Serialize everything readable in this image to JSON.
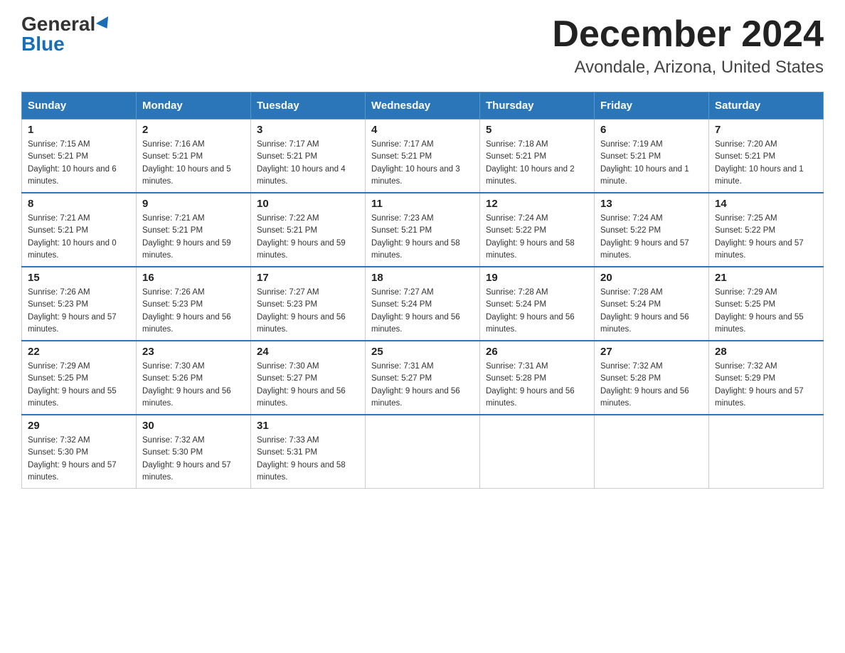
{
  "header": {
    "logo_general": "General",
    "logo_blue": "Blue",
    "title": "December 2024",
    "subtitle": "Avondale, Arizona, United States"
  },
  "days_of_week": [
    "Sunday",
    "Monday",
    "Tuesday",
    "Wednesday",
    "Thursday",
    "Friday",
    "Saturday"
  ],
  "weeks": [
    [
      {
        "day": "1",
        "sunrise": "7:15 AM",
        "sunset": "5:21 PM",
        "daylight": "10 hours and 6 minutes."
      },
      {
        "day": "2",
        "sunrise": "7:16 AM",
        "sunset": "5:21 PM",
        "daylight": "10 hours and 5 minutes."
      },
      {
        "day": "3",
        "sunrise": "7:17 AM",
        "sunset": "5:21 PM",
        "daylight": "10 hours and 4 minutes."
      },
      {
        "day": "4",
        "sunrise": "7:17 AM",
        "sunset": "5:21 PM",
        "daylight": "10 hours and 3 minutes."
      },
      {
        "day": "5",
        "sunrise": "7:18 AM",
        "sunset": "5:21 PM",
        "daylight": "10 hours and 2 minutes."
      },
      {
        "day": "6",
        "sunrise": "7:19 AM",
        "sunset": "5:21 PM",
        "daylight": "10 hours and 1 minute."
      },
      {
        "day": "7",
        "sunrise": "7:20 AM",
        "sunset": "5:21 PM",
        "daylight": "10 hours and 1 minute."
      }
    ],
    [
      {
        "day": "8",
        "sunrise": "7:21 AM",
        "sunset": "5:21 PM",
        "daylight": "10 hours and 0 minutes."
      },
      {
        "day": "9",
        "sunrise": "7:21 AM",
        "sunset": "5:21 PM",
        "daylight": "9 hours and 59 minutes."
      },
      {
        "day": "10",
        "sunrise": "7:22 AM",
        "sunset": "5:21 PM",
        "daylight": "9 hours and 59 minutes."
      },
      {
        "day": "11",
        "sunrise": "7:23 AM",
        "sunset": "5:21 PM",
        "daylight": "9 hours and 58 minutes."
      },
      {
        "day": "12",
        "sunrise": "7:24 AM",
        "sunset": "5:22 PM",
        "daylight": "9 hours and 58 minutes."
      },
      {
        "day": "13",
        "sunrise": "7:24 AM",
        "sunset": "5:22 PM",
        "daylight": "9 hours and 57 minutes."
      },
      {
        "day": "14",
        "sunrise": "7:25 AM",
        "sunset": "5:22 PM",
        "daylight": "9 hours and 57 minutes."
      }
    ],
    [
      {
        "day": "15",
        "sunrise": "7:26 AM",
        "sunset": "5:23 PM",
        "daylight": "9 hours and 57 minutes."
      },
      {
        "day": "16",
        "sunrise": "7:26 AM",
        "sunset": "5:23 PM",
        "daylight": "9 hours and 56 minutes."
      },
      {
        "day": "17",
        "sunrise": "7:27 AM",
        "sunset": "5:23 PM",
        "daylight": "9 hours and 56 minutes."
      },
      {
        "day": "18",
        "sunrise": "7:27 AM",
        "sunset": "5:24 PM",
        "daylight": "9 hours and 56 minutes."
      },
      {
        "day": "19",
        "sunrise": "7:28 AM",
        "sunset": "5:24 PM",
        "daylight": "9 hours and 56 minutes."
      },
      {
        "day": "20",
        "sunrise": "7:28 AM",
        "sunset": "5:24 PM",
        "daylight": "9 hours and 56 minutes."
      },
      {
        "day": "21",
        "sunrise": "7:29 AM",
        "sunset": "5:25 PM",
        "daylight": "9 hours and 55 minutes."
      }
    ],
    [
      {
        "day": "22",
        "sunrise": "7:29 AM",
        "sunset": "5:25 PM",
        "daylight": "9 hours and 55 minutes."
      },
      {
        "day": "23",
        "sunrise": "7:30 AM",
        "sunset": "5:26 PM",
        "daylight": "9 hours and 56 minutes."
      },
      {
        "day": "24",
        "sunrise": "7:30 AM",
        "sunset": "5:27 PM",
        "daylight": "9 hours and 56 minutes."
      },
      {
        "day": "25",
        "sunrise": "7:31 AM",
        "sunset": "5:27 PM",
        "daylight": "9 hours and 56 minutes."
      },
      {
        "day": "26",
        "sunrise": "7:31 AM",
        "sunset": "5:28 PM",
        "daylight": "9 hours and 56 minutes."
      },
      {
        "day": "27",
        "sunrise": "7:32 AM",
        "sunset": "5:28 PM",
        "daylight": "9 hours and 56 minutes."
      },
      {
        "day": "28",
        "sunrise": "7:32 AM",
        "sunset": "5:29 PM",
        "daylight": "9 hours and 57 minutes."
      }
    ],
    [
      {
        "day": "29",
        "sunrise": "7:32 AM",
        "sunset": "5:30 PM",
        "daylight": "9 hours and 57 minutes."
      },
      {
        "day": "30",
        "sunrise": "7:32 AM",
        "sunset": "5:30 PM",
        "daylight": "9 hours and 57 minutes."
      },
      {
        "day": "31",
        "sunrise": "7:33 AM",
        "sunset": "5:31 PM",
        "daylight": "9 hours and 58 minutes."
      },
      null,
      null,
      null,
      null
    ]
  ]
}
